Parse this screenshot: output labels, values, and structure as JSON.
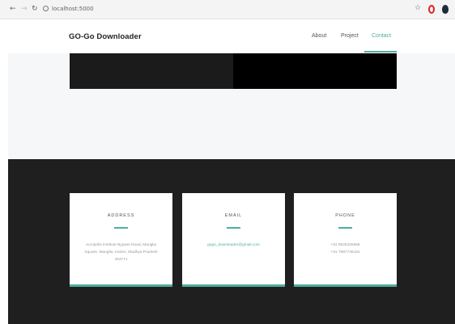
{
  "browser": {
    "url": "localhost:5000",
    "icons": [
      "back-arrow-icon",
      "forward-arrow-icon",
      "reload-icon",
      "info-icon",
      "star-icon",
      "opera-icon",
      "extension-icon"
    ]
  },
  "navbar": {
    "brand": "GO-Go Downloader",
    "links": [
      {
        "label": "About"
      },
      {
        "label": "Project"
      },
      {
        "label": "Contact"
      }
    ],
    "active_color": "#4fae9d"
  },
  "contact": {
    "cards": [
      {
        "title": "ADDRESS",
        "lines": [
          "Acropolis Institute Bypass Road, Manglia",
          "Square, Manglia, Indore, Madhya Pradesh",
          "453771"
        ]
      },
      {
        "title": "EMAIL",
        "lines": [
          "gogo_downloader@gmail.com"
        ]
      },
      {
        "title": "PHONE",
        "lines": [
          "+91 9826325596",
          "+91 7987746181"
        ]
      }
    ]
  },
  "footer": {
    "text": ""
  }
}
